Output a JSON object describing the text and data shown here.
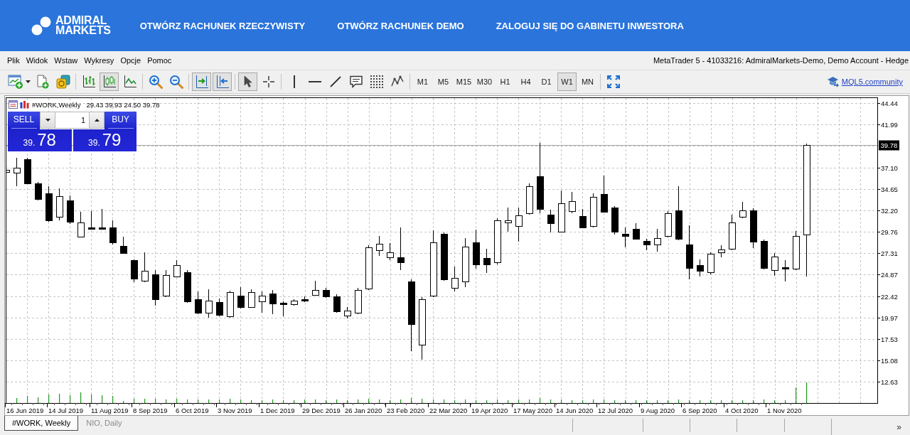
{
  "banner": {
    "logo": [
      "ADMIRAL",
      "MARKETS"
    ],
    "nav": [
      "OTWÓRZ RACHUNEK RZECZYWISTY",
      "OTWÓRZ RACHUNEK DEMO",
      "ZALOGUJ SIĘ DO GABINETU INWESTORA"
    ]
  },
  "menu": [
    "Plik",
    "Widok",
    "Wstaw",
    "Wykresy",
    "Opcje",
    "Pomoc"
  ],
  "window_title": "MetaTrader 5 - 41033216: AdmiralMarkets-Demo, Demo Account - Hedge",
  "toolbar": {
    "chart_types": [
      {
        "selected": false
      },
      {
        "selected": true
      },
      {
        "selected": false
      }
    ],
    "chart_shift": true,
    "auto_scroll": true,
    "cursor_modes": [
      {
        "selected": true
      },
      {
        "selected": false
      }
    ],
    "timeframes": [
      {
        "label": "M1",
        "selected": false
      },
      {
        "label": "M5",
        "selected": false
      },
      {
        "label": "M15",
        "selected": false
      },
      {
        "label": "M30",
        "selected": false
      },
      {
        "label": "H1",
        "selected": false
      },
      {
        "label": "H4",
        "selected": false
      },
      {
        "label": "D1",
        "selected": false
      },
      {
        "label": "W1",
        "selected": true
      },
      {
        "label": "MN",
        "selected": false
      }
    ],
    "community_link": "MQL5.community"
  },
  "chart": {
    "symbol": "#WORK,Weekly",
    "ohlc": "29.43 39.93 24.50 39.78",
    "one_click": {
      "sell_label": "SELL",
      "buy_label": "BUY",
      "volume": "1",
      "sell_price": {
        "head": "39.",
        "tail": "78"
      },
      "buy_price": {
        "head": "39.",
        "tail": "79"
      }
    },
    "price_axis": [
      "44.44",
      "41.99",
      "37.10",
      "34.65",
      "32.20",
      "29.76",
      "27.31",
      "24.87",
      "22.42",
      "19.97",
      "17.53",
      "15.08",
      "12.63"
    ],
    "bid_price": "39.78",
    "time_axis": [
      "16 Jun 2019",
      "14 Jul 2019",
      "11 Aug 2019",
      "8 Sep 2019",
      "6 Oct 2019",
      "3 Nov 2019",
      "1 Dec 2019",
      "29 Dec 2019",
      "26 Jan 2020",
      "23 Feb 2020",
      "22 Mar 2020",
      "19 Apr 2020",
      "17 May 2020",
      "14 Jun 2020",
      "12 Jul 2020",
      "9 Aug 2020",
      "6 Sep 2020",
      "4 Oct 2020",
      "1 Nov 2020"
    ]
  },
  "tabs": [
    {
      "label": "#WORK, Weekly",
      "selected": true
    },
    {
      "label": "NIO, Daily",
      "selected": false
    }
  ],
  "tab_scroll": "»"
}
